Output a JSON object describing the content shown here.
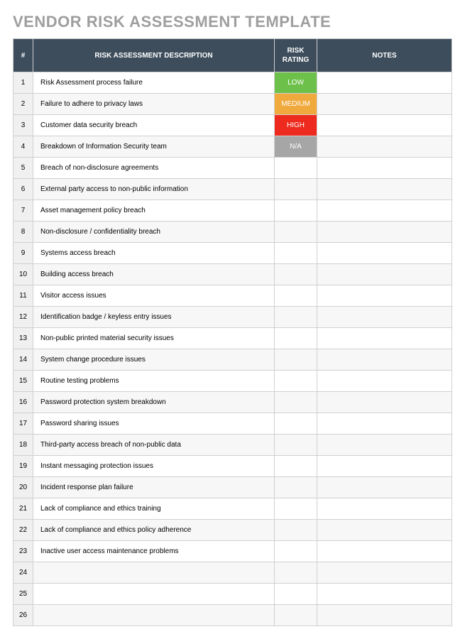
{
  "title": "VENDOR RISK ASSESSMENT TEMPLATE",
  "headers": {
    "num": "#",
    "description": "RISK ASSESSMENT DESCRIPTION",
    "rating": "RISK RATING",
    "notes": "NOTES"
  },
  "rating_colors": {
    "LOW": "#6dc14a",
    "MEDIUM": "#f0a93c",
    "HIGH": "#ed2a1d",
    "N/A": "#a6a6a6"
  },
  "rows": [
    {
      "num": "1",
      "description": "Risk Assessment process failure",
      "rating": "LOW",
      "notes": ""
    },
    {
      "num": "2",
      "description": "Failure to adhere to privacy laws",
      "rating": "MEDIUM",
      "notes": ""
    },
    {
      "num": "3",
      "description": "Customer data security breach",
      "rating": "HIGH",
      "notes": ""
    },
    {
      "num": "4",
      "description": "Breakdown of Information Security team",
      "rating": "N/A",
      "notes": ""
    },
    {
      "num": "5",
      "description": "Breach of non-disclosure agreements",
      "rating": "",
      "notes": ""
    },
    {
      "num": "6",
      "description": "External party access to non-public information",
      "rating": "",
      "notes": ""
    },
    {
      "num": "7",
      "description": "Asset management policy breach",
      "rating": "",
      "notes": ""
    },
    {
      "num": "8",
      "description": "Non-disclosure / confidentiality breach",
      "rating": "",
      "notes": ""
    },
    {
      "num": "9",
      "description": "Systems access breach",
      "rating": "",
      "notes": ""
    },
    {
      "num": "10",
      "description": "Building access breach",
      "rating": "",
      "notes": ""
    },
    {
      "num": "11",
      "description": "Visitor access issues",
      "rating": "",
      "notes": ""
    },
    {
      "num": "12",
      "description": "Identification badge / keyless entry issues",
      "rating": "",
      "notes": ""
    },
    {
      "num": "13",
      "description": "Non-public printed material security issues",
      "rating": "",
      "notes": ""
    },
    {
      "num": "14",
      "description": "System change procedure issues",
      "rating": "",
      "notes": ""
    },
    {
      "num": "15",
      "description": "Routine testing problems",
      "rating": "",
      "notes": ""
    },
    {
      "num": "16",
      "description": "Password protection system breakdown",
      "rating": "",
      "notes": ""
    },
    {
      "num": "17",
      "description": "Password sharing issues",
      "rating": "",
      "notes": ""
    },
    {
      "num": "18",
      "description": "Third-party access breach of non-public data",
      "rating": "",
      "notes": ""
    },
    {
      "num": "19",
      "description": "Instant messaging protection issues",
      "rating": "",
      "notes": ""
    },
    {
      "num": "20",
      "description": "Incident response plan failure",
      "rating": "",
      "notes": ""
    },
    {
      "num": "21",
      "description": "Lack of compliance and ethics training",
      "rating": "",
      "notes": ""
    },
    {
      "num": "22",
      "description": "Lack of compliance and ethics policy adherence",
      "rating": "",
      "notes": ""
    },
    {
      "num": "23",
      "description": "Inactive user access maintenance problems",
      "rating": "",
      "notes": ""
    },
    {
      "num": "24",
      "description": "",
      "rating": "",
      "notes": ""
    },
    {
      "num": "25",
      "description": "",
      "rating": "",
      "notes": ""
    },
    {
      "num": "26",
      "description": "",
      "rating": "",
      "notes": ""
    }
  ]
}
